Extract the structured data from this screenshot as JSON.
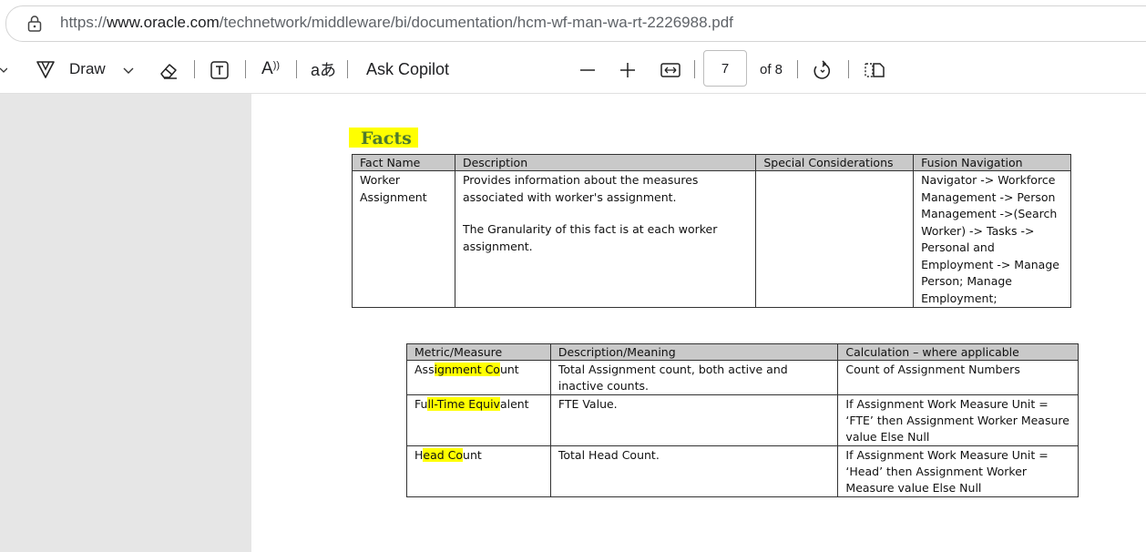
{
  "browser": {
    "url_prefix": "https://",
    "url_domain": "www.oracle.com",
    "url_path": "/technetwork/middleware/bi/documentation/hcm-wf-man-wa-rt-2226988.pdf"
  },
  "toolbar": {
    "draw_label": "Draw",
    "ask_copilot_label": "Ask Copilot",
    "page_number": "7",
    "page_total": "of 8",
    "read_aloud_glyph": "A",
    "translate_glyph": "aあ"
  },
  "document": {
    "facts_heading": "Facts",
    "facts_table": {
      "headers": [
        "Fact Name",
        "Description",
        "Special Considerations",
        "Fusion Navigation"
      ],
      "row": {
        "fact_name": "Worker Assignment",
        "description_1": "Provides information about the measures associated with worker's assignment.",
        "description_2": "The Granularity of this fact is at each worker assignment.",
        "special": "",
        "navigation": "Navigator -> Workforce Management -> Person Management ->(Search Worker) -> Tasks -> Personal and Employment -> Manage Person; Manage Employment;"
      }
    },
    "metrics_table": {
      "headers": [
        "Metric/Measure",
        "Description/Meaning",
        "Calculation – where applicable"
      ],
      "rows": [
        {
          "metric_pre": "Ass",
          "metric_hl": "ignment Co",
          "metric_post": "unt",
          "description": "Total Assignment count, both active and inactive counts.",
          "calculation": "Count of Assignment Numbers"
        },
        {
          "metric_pre": "Fu",
          "metric_hl": "ll-Time Equiv",
          "metric_post": "alent",
          "description": "FTE Value.",
          "calculation": "If Assignment Work Measure Unit = ‘FTE’ then Assignment Worker Measure value Else Null"
        },
        {
          "metric_pre": "H",
          "metric_hl": "ead Co",
          "metric_post": "unt",
          "description": "Total Head Count.",
          "calculation": "If Assignment Work Measure Unit = ‘Head’ then Assignment Worker Measure value Else Null"
        }
      ]
    }
  },
  "colors": {
    "highlight": "#ffff00",
    "heading": "#4e7a2e",
    "table_header": "#c9c9c9",
    "side_pane": "#e6e6e6"
  },
  "icons": [
    "lock-icon",
    "draw-icon",
    "chevron-down-icon",
    "eraser-icon",
    "text-box-icon",
    "read-aloud-icon",
    "translate-icon",
    "zoom-out-icon",
    "zoom-in-icon",
    "fit-width-icon",
    "rotate-icon",
    "page-view-icon"
  ]
}
